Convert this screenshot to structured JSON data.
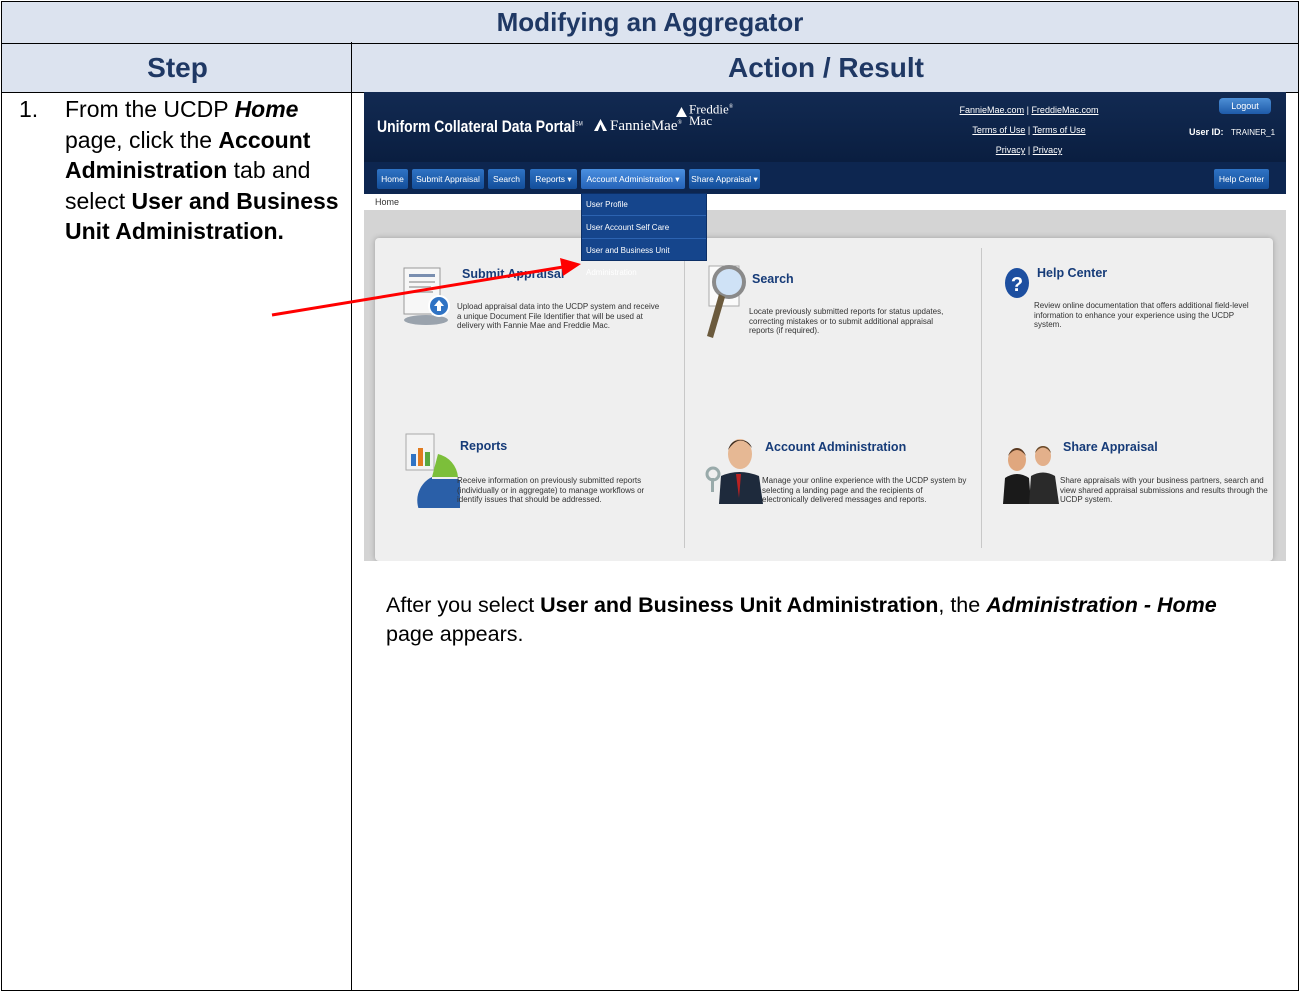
{
  "document": {
    "title": "Modifying an Aggregator",
    "headers": {
      "step": "Step",
      "action": "Action / Result"
    },
    "step": {
      "number": "1.",
      "text_1": "From the UCDP ",
      "text_2": "Home",
      "text_3": " page, click the ",
      "text_4": "Account Administration",
      "text_5": " tab and select ",
      "text_6": "User and Business Unit Administration."
    },
    "result": {
      "text_1": "After you select ",
      "text_2": "User and Business Unit Administration",
      "text_3": ", the ",
      "text_4": "Administration - Home",
      "text_5": " page appears."
    },
    "arrow_color": "#ff0000"
  },
  "ucdp": {
    "brand": "Uniform Collateral Data Portal",
    "brand_mark": "SM",
    "fannie": "FannieMae",
    "freddie_1": "Freddie",
    "freddie_2": "Mac",
    "links": {
      "fannie_site": "FannieMae.com",
      "freddie_site": "FreddieMac.com",
      "terms_1": "Terms of Use",
      "terms_2": "Terms of Use",
      "privacy_1": "Privacy",
      "privacy_2": "Privacy",
      "sep": "|"
    },
    "logout": "Logout",
    "user_id_label": "User ID:",
    "user_id_value": "TRAINER_1",
    "nav": {
      "home": "Home",
      "submit_appraisal": "Submit Appraisal",
      "search": "Search",
      "reports": "Reports ▾",
      "account_admin": "Account Administration ▾",
      "share_appraisal": "Share Appraisal ▾",
      "help_center": "Help Center"
    },
    "breadcrumb": "Home",
    "menu": [
      "User Profile",
      "User Account Self Care",
      "User and Business Unit Administration"
    ],
    "cards": {
      "submit": {
        "title": "Submit Appraisal",
        "text": "Upload appraisal data into the UCDP system and receive a unique Document File Identifier that will be used at delivery with Fannie Mae and Freddie Mac."
      },
      "search": {
        "title": "Search",
        "text": "Locate previously submitted reports for status updates, correcting mistakes or to submit additional appraisal reports (if required)."
      },
      "help": {
        "title": "Help Center",
        "text": "Review online documentation that offers additional field-level information to enhance your experience using the UCDP system."
      },
      "reports": {
        "title": "Reports",
        "text": "Receive information on previously submitted reports (individually or in aggregate) to manage workflows or identify issues that should be addressed."
      },
      "account": {
        "title": "Account Administration",
        "text": "Manage your online experience with the UCDP system by selecting a landing page and the recipients of electronically delivered messages and reports."
      },
      "share": {
        "title": "Share Appraisal",
        "text": "Share appraisals with your business partners, search and view shared appraisal submissions and results through the UCDP system."
      }
    },
    "colors": {
      "header": "#122a52",
      "nav": "#0d2650",
      "tab": "#1f5fae",
      "menu": "#15458c",
      "card_title": "#163b78"
    }
  }
}
